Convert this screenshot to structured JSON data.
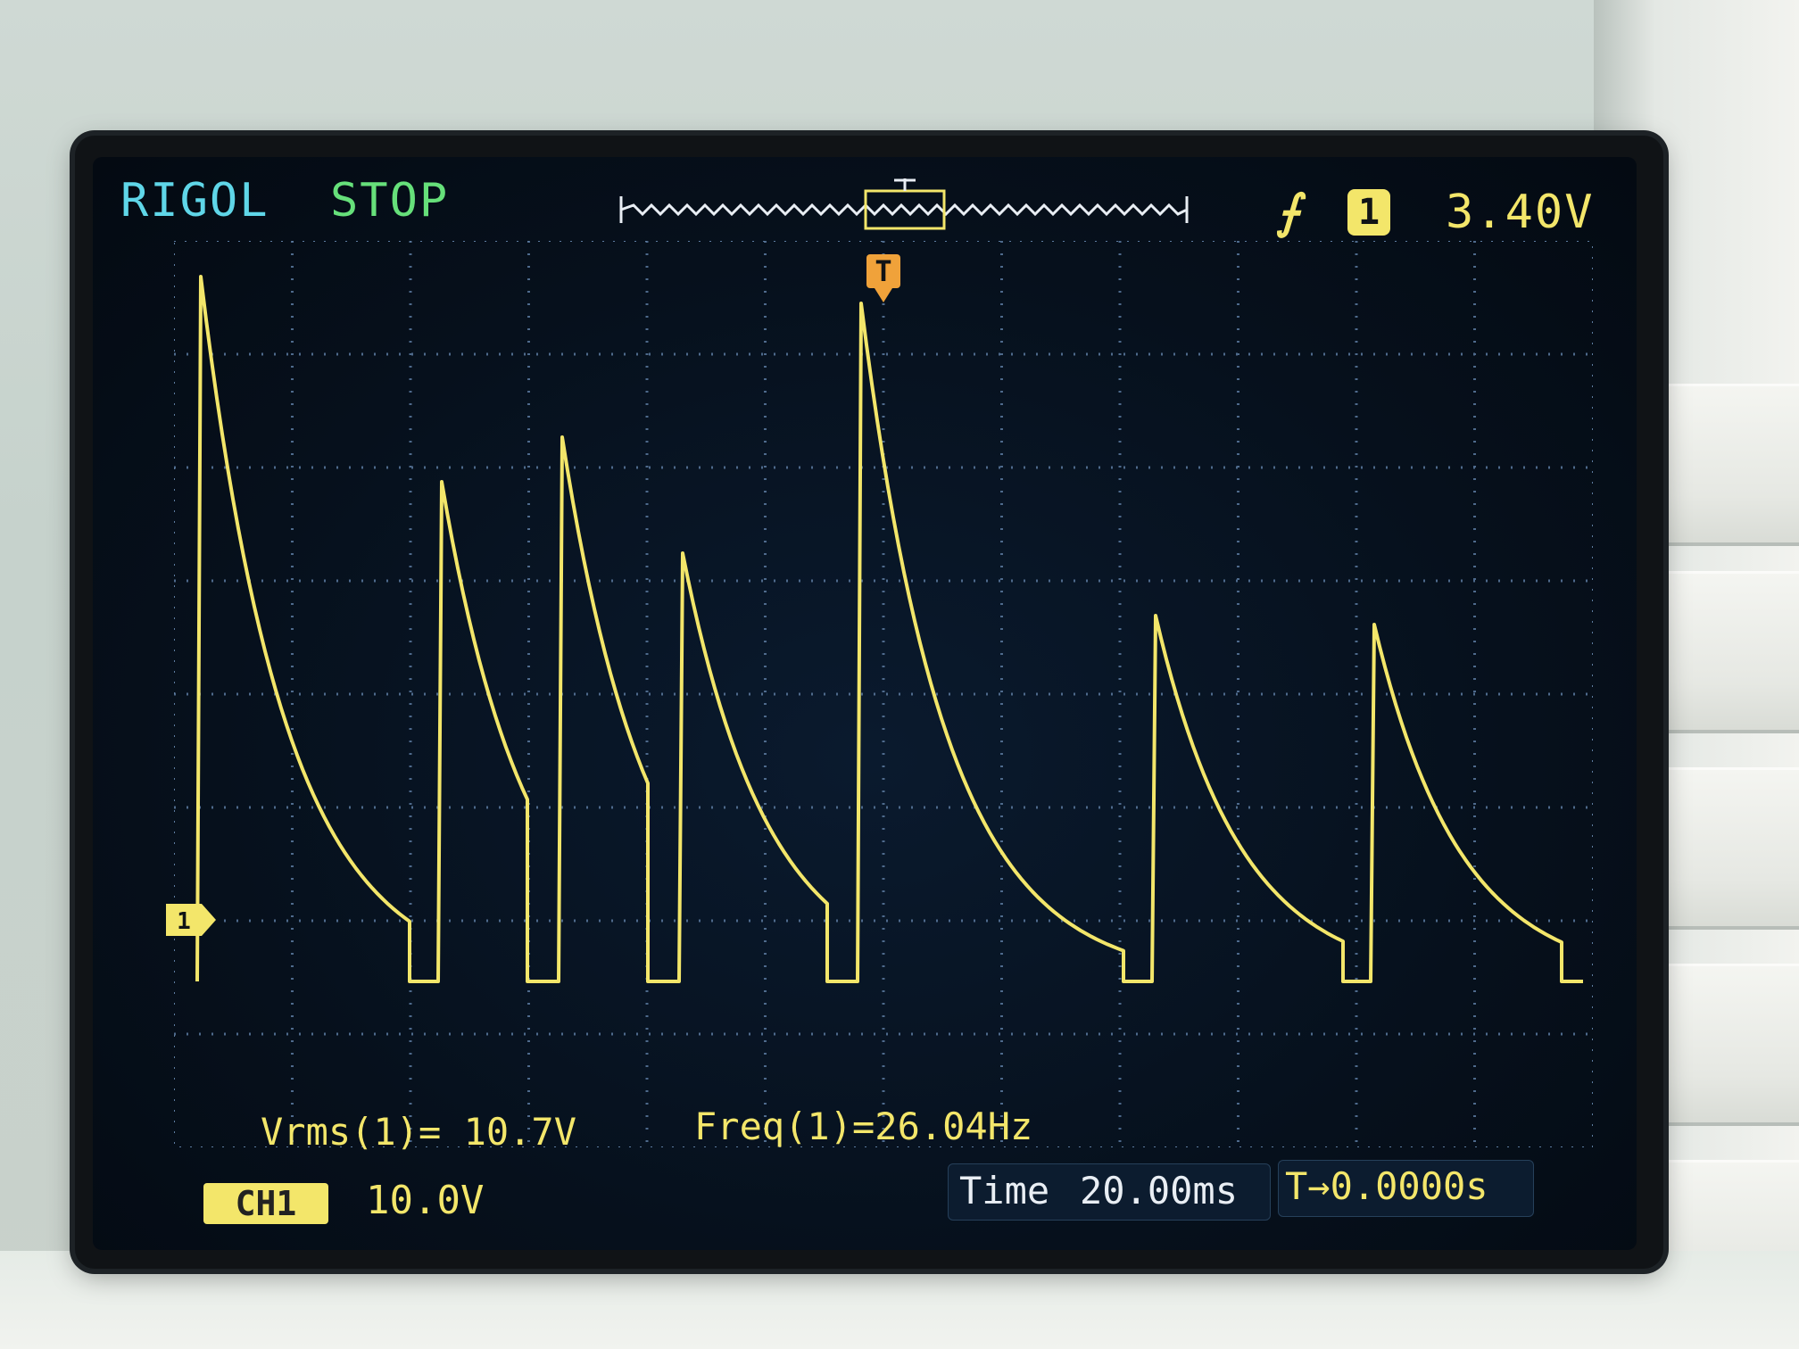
{
  "brand": "RIGOL",
  "run_state": "STOP",
  "trigger": {
    "edge_icon": "rising-edge-icon",
    "source": "1",
    "level": "3.40V"
  },
  "channel": {
    "badge": "CH1",
    "marker": "1",
    "scale": "10.0V"
  },
  "measurements": {
    "vrms": "Vrms(1)= 10.7V",
    "freq": "Freq(1)=26.04Hz"
  },
  "timebase": {
    "label": "Time",
    "value": "20.00ms",
    "trigger_offset": "T→0.0000s"
  },
  "colors": {
    "trace": "#f3e66a",
    "brand": "#5fd6e8",
    "stop": "#66e07a",
    "grid": "#4e6a8c"
  }
}
